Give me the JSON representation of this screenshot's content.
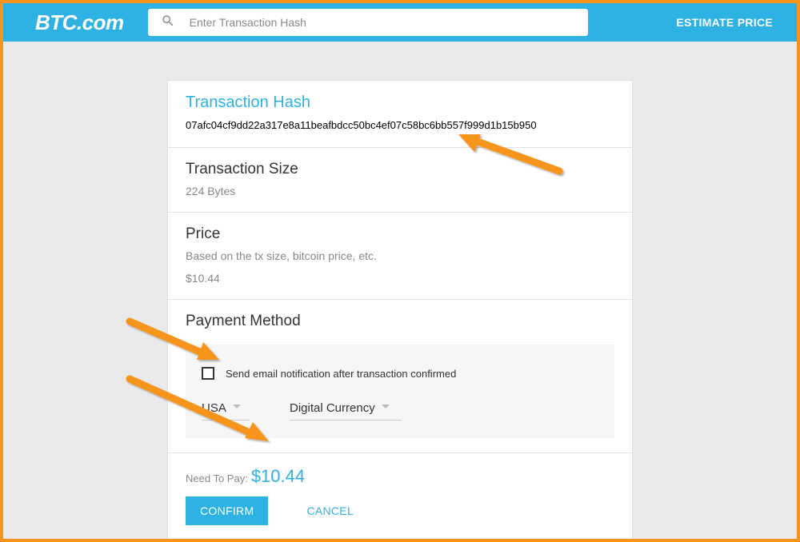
{
  "header": {
    "logo": "BTC.com",
    "search_placeholder": "Enter Transaction Hash",
    "estimate_label": "ESTIMATE PRICE"
  },
  "tx_hash": {
    "title": "Transaction Hash",
    "value": "07afc04cf9dd22a317e8a11beafbdcc50bc4ef07c58bc6bb557f999d1b15b950"
  },
  "tx_size": {
    "title": "Transaction Size",
    "value": "224 Bytes"
  },
  "price": {
    "title": "Price",
    "desc": "Based on the tx size, bitcoin price, etc.",
    "value": "$10.44"
  },
  "payment": {
    "title": "Payment Method",
    "email_label": "Send email notification after transaction confirmed",
    "country": "USA",
    "method": "Digital Currency"
  },
  "footer": {
    "need_label": "Need To Pay:",
    "amount": "$10.44",
    "confirm": "CONFIRM",
    "cancel": "CANCEL"
  }
}
